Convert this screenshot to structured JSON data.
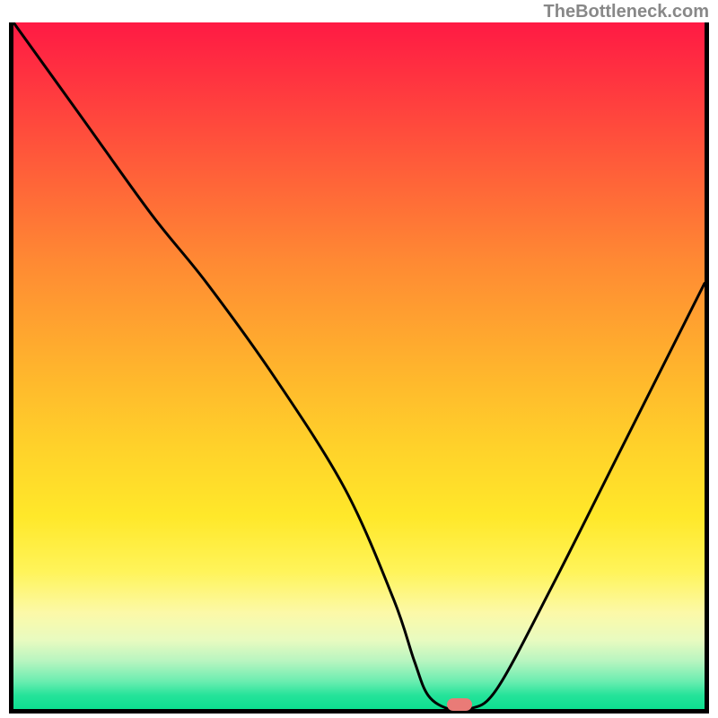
{
  "watermark": "TheBottleneck.com",
  "chart_data": {
    "type": "line",
    "title": "",
    "xlabel": "",
    "ylabel": "",
    "x_range": [
      0,
      100
    ],
    "y_range": [
      0,
      100
    ],
    "background_gradient": {
      "top": "#ff1a44",
      "bottom": "#0ddf90",
      "meaning": "red=bottleneck, green=balanced"
    },
    "series": [
      {
        "name": "bottleneck-curve",
        "x": [
          0,
          10,
          20,
          28,
          38,
          48,
          55,
          58,
          60,
          63,
          66,
          70,
          78,
          88,
          100
        ],
        "values": [
          100,
          86,
          72,
          62,
          48,
          32,
          16,
          7,
          2,
          0,
          0,
          3,
          18,
          38,
          62
        ]
      }
    ],
    "marker": {
      "x": 64.5,
      "y": 0,
      "color": "#e97b77"
    }
  }
}
